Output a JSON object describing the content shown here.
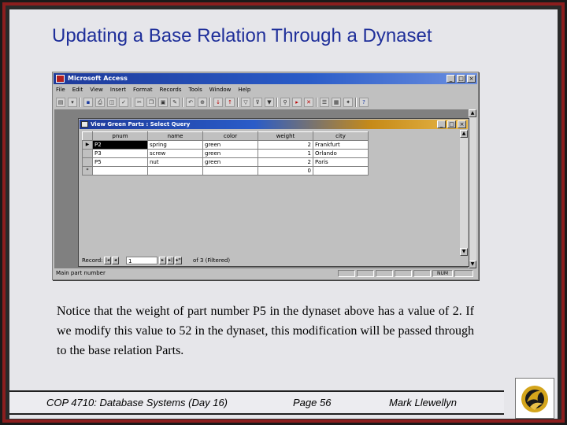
{
  "slide": {
    "title": "Updating a Base Relation Through a Dynaset",
    "body": "Notice that the weight of part number P5 in the dynaset above has a value of 2.  If we modify this value to 52 in the dynaset, this modification will be passed through to the base relation Parts."
  },
  "access": {
    "title": "Microsoft Access",
    "menu": [
      "File",
      "Edit",
      "View",
      "Insert",
      "Format",
      "Records",
      "Tools",
      "Window",
      "Help"
    ],
    "win_buttons": [
      "_",
      "□",
      "×"
    ],
    "toolbar_icons": [
      "view-icon",
      "dropdown-icon",
      "save-icon",
      "print-icon",
      "print-preview-icon",
      "spelling-icon",
      "cut-icon",
      "copy-icon",
      "paste-icon",
      "format-painter-icon",
      "undo-icon",
      "hyperlink-icon",
      "sort-ascending-icon",
      "sort-descending-icon",
      "filter-by-selection-icon",
      "filter-by-form-icon",
      "apply-filter-icon",
      "find-icon",
      "new-record-icon",
      "delete-record-icon",
      "properties-icon",
      "database-window-icon",
      "new-object-icon",
      "help-icon"
    ],
    "status": {
      "text": "Main part number",
      "num": "NUM"
    },
    "query": {
      "title": "View Green Parts : Select Query",
      "columns": [
        "pnum",
        "name",
        "color",
        "weight",
        "city"
      ],
      "rows": [
        {
          "marker": "▶",
          "pnum": "P2",
          "name": "spring",
          "color": "green",
          "weight": "2",
          "city": "Frankfurt",
          "selected": true
        },
        {
          "marker": "",
          "pnum": "P3",
          "name": "screw",
          "color": "green",
          "weight": "1",
          "city": "Orlando",
          "selected": false
        },
        {
          "marker": "",
          "pnum": "P5",
          "name": "nut",
          "color": "green",
          "weight": "2",
          "city": "Paris",
          "selected": false
        },
        {
          "marker": "*",
          "pnum": "",
          "name": "",
          "color": "",
          "weight": "0",
          "city": "",
          "selected": false
        }
      ],
      "nav": {
        "label": "Record:",
        "current": "1",
        "of_text": "of 3 (Filtered)"
      }
    }
  },
  "footer": {
    "course": "COP 4710: Database Systems  (Day 16)",
    "page": "Page 56",
    "author": "Mark Llewellyn"
  }
}
